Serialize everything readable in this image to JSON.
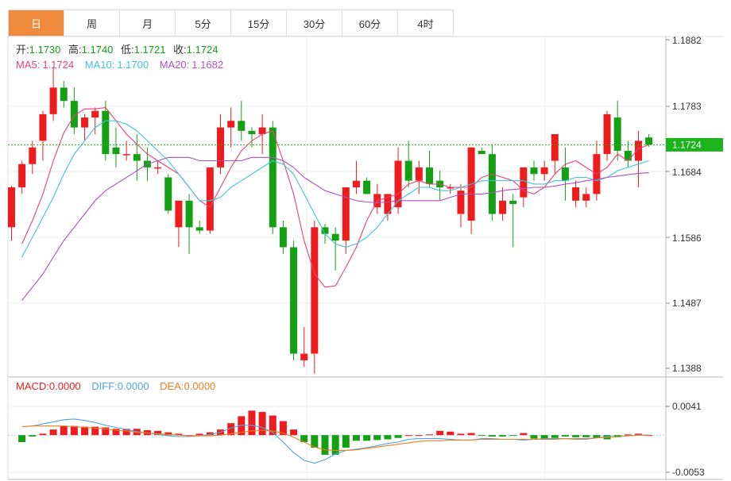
{
  "tabs": [
    {
      "label": "日",
      "active": true
    },
    {
      "label": "周",
      "active": false
    },
    {
      "label": "月",
      "active": false
    },
    {
      "label": "5分",
      "active": false
    },
    {
      "label": "15分",
      "active": false
    },
    {
      "label": "30分",
      "active": false
    },
    {
      "label": "60分",
      "active": false
    },
    {
      "label": "4时",
      "active": false
    }
  ],
  "ohlc_info": {
    "open_label": "开:",
    "open_value": "1.1730",
    "high_label": "高:",
    "high_value": "1.1740",
    "low_label": "低:",
    "low_value": "1.1721",
    "close_label": "收:",
    "close_value": "1.1724"
  },
  "ma_info": {
    "ma5_label": "MA5:",
    "ma5_value": "1.1724",
    "ma10_label": "MA10:",
    "ma10_value": "1.1700",
    "ma20_label": "MA20:",
    "ma20_value": "1.1682"
  },
  "macd_info": {
    "macd_label": "MACD:",
    "macd_value": "0.0000",
    "diff_label": "DIFF:",
    "diff_value": "0.0000",
    "dea_label": "DEA:",
    "dea_value": "0.0000"
  },
  "current_price_tag": "1.1724",
  "colors": {
    "up": "#ee1c1c",
    "down": "#13a013",
    "ma5": "#e8407a",
    "ma10": "#3ec3d9",
    "ma20": "#b14fc2",
    "diff": "#4ba7e0",
    "dea": "#ef7e1f",
    "grid": "#e6e6e6",
    "price_tag": "#1db31d",
    "tab_active": "#ef8a3c"
  },
  "chart_data": [
    {
      "type": "candlestick",
      "y_ticks": [
        "1.1882",
        "1.1783",
        "1.1684",
        "1.1586",
        "1.1487",
        "1.1388"
      ],
      "ylim": [
        1.1388,
        1.1882
      ],
      "current_price": 1.1724,
      "candles": [
        [
          1.16,
          1.1662,
          1.158,
          1.166
        ],
        [
          1.166,
          1.17,
          1.165,
          1.1695
        ],
        [
          1.1695,
          1.173,
          1.168,
          1.172
        ],
        [
          1.173,
          1.1775,
          1.17,
          1.177
        ],
        [
          1.177,
          1.184,
          1.176,
          1.181
        ],
        [
          1.181,
          1.182,
          1.178,
          1.179
        ],
        [
          1.179,
          1.181,
          1.174,
          1.175
        ],
        [
          1.175,
          1.177,
          1.173,
          1.1765
        ],
        [
          1.1765,
          1.178,
          1.174,
          1.1775
        ],
        [
          1.1775,
          1.179,
          1.17,
          1.171
        ],
        [
          1.172,
          1.175,
          1.169,
          1.171
        ],
        [
          1.171,
          1.173,
          1.17,
          1.171
        ],
        [
          1.171,
          1.174,
          1.167,
          1.17
        ],
        [
          1.17,
          1.172,
          1.167,
          1.169
        ],
        [
          1.169,
          1.17,
          1.168,
          1.169
        ],
        [
          1.1675,
          1.168,
          1.162,
          1.1625
        ],
        [
          1.16,
          1.164,
          1.157,
          1.164
        ],
        [
          1.164,
          1.165,
          1.156,
          1.16
        ],
        [
          1.16,
          1.161,
          1.159,
          1.1595
        ],
        [
          1.1595,
          1.168,
          1.159,
          1.169
        ],
        [
          1.169,
          1.177,
          1.168,
          1.175
        ],
        [
          1.175,
          1.178,
          1.172,
          1.176
        ],
        [
          1.176,
          1.179,
          1.173,
          1.1745
        ],
        [
          1.1745,
          1.175,
          1.172,
          1.174
        ],
        [
          1.174,
          1.177,
          1.171,
          1.175
        ],
        [
          1.175,
          1.176,
          1.159,
          1.16
        ],
        [
          1.16,
          1.161,
          1.156,
          1.157
        ],
        [
          1.157,
          1.158,
          1.14,
          1.141
        ],
        [
          1.14,
          1.145,
          1.139,
          1.141
        ],
        [
          1.141,
          1.161,
          1.138,
          1.16
        ],
        [
          1.16,
          1.1605,
          1.1575,
          1.159
        ],
        [
          1.159,
          1.16,
          1.1535,
          1.158
        ],
        [
          1.158,
          1.166,
          1.156,
          1.166
        ],
        [
          1.166,
          1.17,
          1.165,
          1.167
        ],
        [
          1.167,
          1.1675,
          1.165,
          1.165
        ],
        [
          1.163,
          1.1665,
          1.162,
          1.165
        ],
        [
          1.162,
          1.165,
          1.161,
          1.165
        ],
        [
          1.163,
          1.172,
          1.162,
          1.17
        ],
        [
          1.17,
          1.173,
          1.166,
          1.167
        ],
        [
          1.167,
          1.17,
          1.165,
          1.169
        ],
        [
          1.169,
          1.1715,
          1.166,
          1.1665
        ],
        [
          1.167,
          1.1685,
          1.164,
          1.166
        ],
        [
          1.166,
          1.1665,
          1.165,
          1.166
        ],
        [
          1.162,
          1.1665,
          1.16,
          1.1655
        ],
        [
          1.161,
          1.172,
          1.159,
          1.172
        ],
        [
          1.1715,
          1.172,
          1.171,
          1.171
        ],
        [
          1.171,
          1.1725,
          1.161,
          1.162
        ],
        [
          1.162,
          1.166,
          1.161,
          1.164
        ],
        [
          1.164,
          1.165,
          1.157,
          1.1635
        ],
        [
          1.1645,
          1.169,
          1.163,
          1.169
        ],
        [
          1.169,
          1.17,
          1.167,
          1.168
        ],
        [
          1.168,
          1.17,
          1.167,
          1.169
        ],
        [
          1.17,
          1.174,
          1.168,
          1.174
        ],
        [
          1.169,
          1.172,
          1.164,
          1.167
        ],
        [
          1.164,
          1.167,
          1.163,
          1.166
        ],
        [
          1.164,
          1.166,
          1.163,
          1.165
        ],
        [
          1.165,
          1.173,
          1.164,
          1.171
        ],
        [
          1.171,
          1.1775,
          1.17,
          1.177
        ],
        [
          1.1765,
          1.179,
          1.17,
          1.1715
        ],
        [
          1.1715,
          1.173,
          1.169,
          1.17
        ],
        [
          1.17,
          1.1745,
          1.166,
          1.173
        ],
        [
          1.1735,
          1.174,
          1.1721,
          1.1724
        ]
      ],
      "ma5": [
        1.1575,
        1.161,
        1.165,
        1.17,
        1.1742,
        1.1768,
        1.1778,
        1.1778,
        1.178,
        1.176,
        1.174,
        1.1725,
        1.171,
        1.17,
        1.169,
        1.168,
        1.166,
        1.164,
        1.163,
        1.166,
        1.169,
        1.1715,
        1.173,
        1.174,
        1.1745,
        1.17,
        1.165,
        1.158,
        1.153,
        1.151,
        1.1512,
        1.154,
        1.157,
        1.161,
        1.164,
        1.1645,
        1.165,
        1.1665,
        1.167,
        1.1665,
        1.1665,
        1.166,
        1.166,
        1.166,
        1.1675,
        1.168,
        1.1675,
        1.167,
        1.1655,
        1.165,
        1.166,
        1.168,
        1.1695,
        1.17,
        1.169,
        1.168,
        1.169,
        1.171,
        1.17,
        1.1718,
        1.1724
      ],
      "ma10": [
        1.1555,
        1.1585,
        1.1615,
        1.1645,
        1.168,
        1.171,
        1.173,
        1.175,
        1.176,
        1.176,
        1.1755,
        1.1745,
        1.173,
        1.1715,
        1.17,
        1.168,
        1.166,
        1.164,
        1.164,
        1.1645,
        1.166,
        1.167,
        1.168,
        1.169,
        1.17,
        1.1695,
        1.168,
        1.165,
        1.162,
        1.159,
        1.1575,
        1.157,
        1.1575,
        1.1585,
        1.16,
        1.162,
        1.164,
        1.165,
        1.166,
        1.166,
        1.1655,
        1.1655,
        1.166,
        1.1665,
        1.167,
        1.167,
        1.167,
        1.167,
        1.167,
        1.1665,
        1.1665,
        1.167,
        1.167,
        1.1675,
        1.1675,
        1.167,
        1.1675,
        1.1685,
        1.169,
        1.1695,
        1.17
      ],
      "ma20": [
        1.149,
        1.151,
        1.153,
        1.1555,
        1.158,
        1.16,
        1.162,
        1.164,
        1.1655,
        1.1665,
        1.1675,
        1.1685,
        1.1695,
        1.17,
        1.1705,
        1.1705,
        1.1705,
        1.17,
        1.17,
        1.17,
        1.17,
        1.17,
        1.1705,
        1.1705,
        1.1705,
        1.17,
        1.169,
        1.1675,
        1.1665,
        1.1655,
        1.165,
        1.1645,
        1.164,
        1.1638,
        1.1637,
        1.1638,
        1.164,
        1.164,
        1.164,
        1.164,
        1.164,
        1.1645,
        1.165,
        1.165,
        1.165,
        1.1652,
        1.1655,
        1.1657,
        1.1658,
        1.166,
        1.166,
        1.1662,
        1.1665,
        1.1667,
        1.167,
        1.1672,
        1.1675,
        1.1677,
        1.1679,
        1.1681,
        1.1682
      ]
    },
    {
      "type": "macd",
      "y_ticks": [
        "0.0041",
        "-0.0053"
      ],
      "ylim": [
        -0.0053,
        0.0041
      ],
      "hist": [
        -0.001,
        -0.0002,
        0.0002,
        0.0008,
        0.0013,
        0.0013,
        0.0012,
        0.0012,
        0.0011,
        0.0009,
        0.0009,
        0.0009,
        0.0007,
        0.0006,
        0.0004,
        0.0002,
        0.0,
        0.0002,
        0.0004,
        0.0008,
        0.0017,
        0.0027,
        0.0035,
        0.0033,
        0.0028,
        0.002,
        0.0008,
        -0.001,
        -0.0018,
        -0.0028,
        -0.0028,
        -0.0018,
        -0.0008,
        -0.0008,
        -0.0007,
        -0.0006,
        -0.0004,
        0.0,
        0.0,
        0.0001,
        0.0006,
        0.0005,
        0.0002,
        0.0003,
        -0.0001,
        -0.0002,
        -0.0002,
        -0.0001,
        0.0003,
        -0.0005,
        -0.0005,
        -0.0004,
        -0.0002,
        -0.0003,
        -0.0003,
        -0.0004,
        -0.0006,
        -0.0003,
        0.0001,
        0.0002,
        0.0
      ],
      "diff": [
        0.0012,
        0.0013,
        0.0016,
        0.0019,
        0.0022,
        0.0023,
        0.0021,
        0.0018,
        0.0014,
        0.0011,
        0.0008,
        0.0005,
        0.0003,
        0.0001,
        -0.0001,
        -0.0002,
        -0.0002,
        -0.0001,
        0.0001,
        0.0004,
        0.001,
        0.0014,
        0.0014,
        0.0011,
        0.0004,
        -0.001,
        -0.0025,
        -0.0036,
        -0.004,
        -0.0035,
        -0.0027,
        -0.0022,
        -0.002,
        -0.0018,
        -0.0015,
        -0.0012,
        -0.001,
        -0.0006,
        -0.0005,
        -0.0005,
        -0.0005,
        -0.0006,
        -0.0007,
        -0.0007,
        -0.0005,
        -0.0005,
        -0.0006,
        -0.0006,
        -0.0007,
        -0.0006,
        -0.0005,
        -0.0005,
        -0.0005,
        -0.0006,
        -0.0006,
        -0.0004,
        -0.0002,
        -0.0002,
        -0.0001,
        0.0,
        0.0
      ],
      "dea": [
        0.0012,
        0.0013,
        0.0013,
        0.0013,
        0.0013,
        0.0012,
        0.0011,
        0.001,
        0.0009,
        0.0007,
        0.0006,
        0.0004,
        0.0003,
        0.0002,
        0.0001,
        0.0,
        -0.0001,
        -0.0001,
        -0.0001,
        0.0,
        0.0002,
        0.0004,
        0.0006,
        0.0007,
        0.0006,
        0.0003,
        -0.0003,
        -0.001,
        -0.0017,
        -0.0021,
        -0.0022,
        -0.0022,
        -0.0021,
        -0.0019,
        -0.0017,
        -0.0015,
        -0.0013,
        -0.0011,
        -0.0009,
        -0.0008,
        -0.0008,
        -0.0007,
        -0.0007,
        -0.0007,
        -0.0006,
        -0.0006,
        -0.0006,
        -0.0006,
        -0.0006,
        -0.0006,
        -0.0006,
        -0.0006,
        -0.0005,
        -0.0005,
        -0.0005,
        -0.0004,
        -0.0003,
        -0.0002,
        -0.0001,
        0.0,
        0.0
      ]
    }
  ]
}
